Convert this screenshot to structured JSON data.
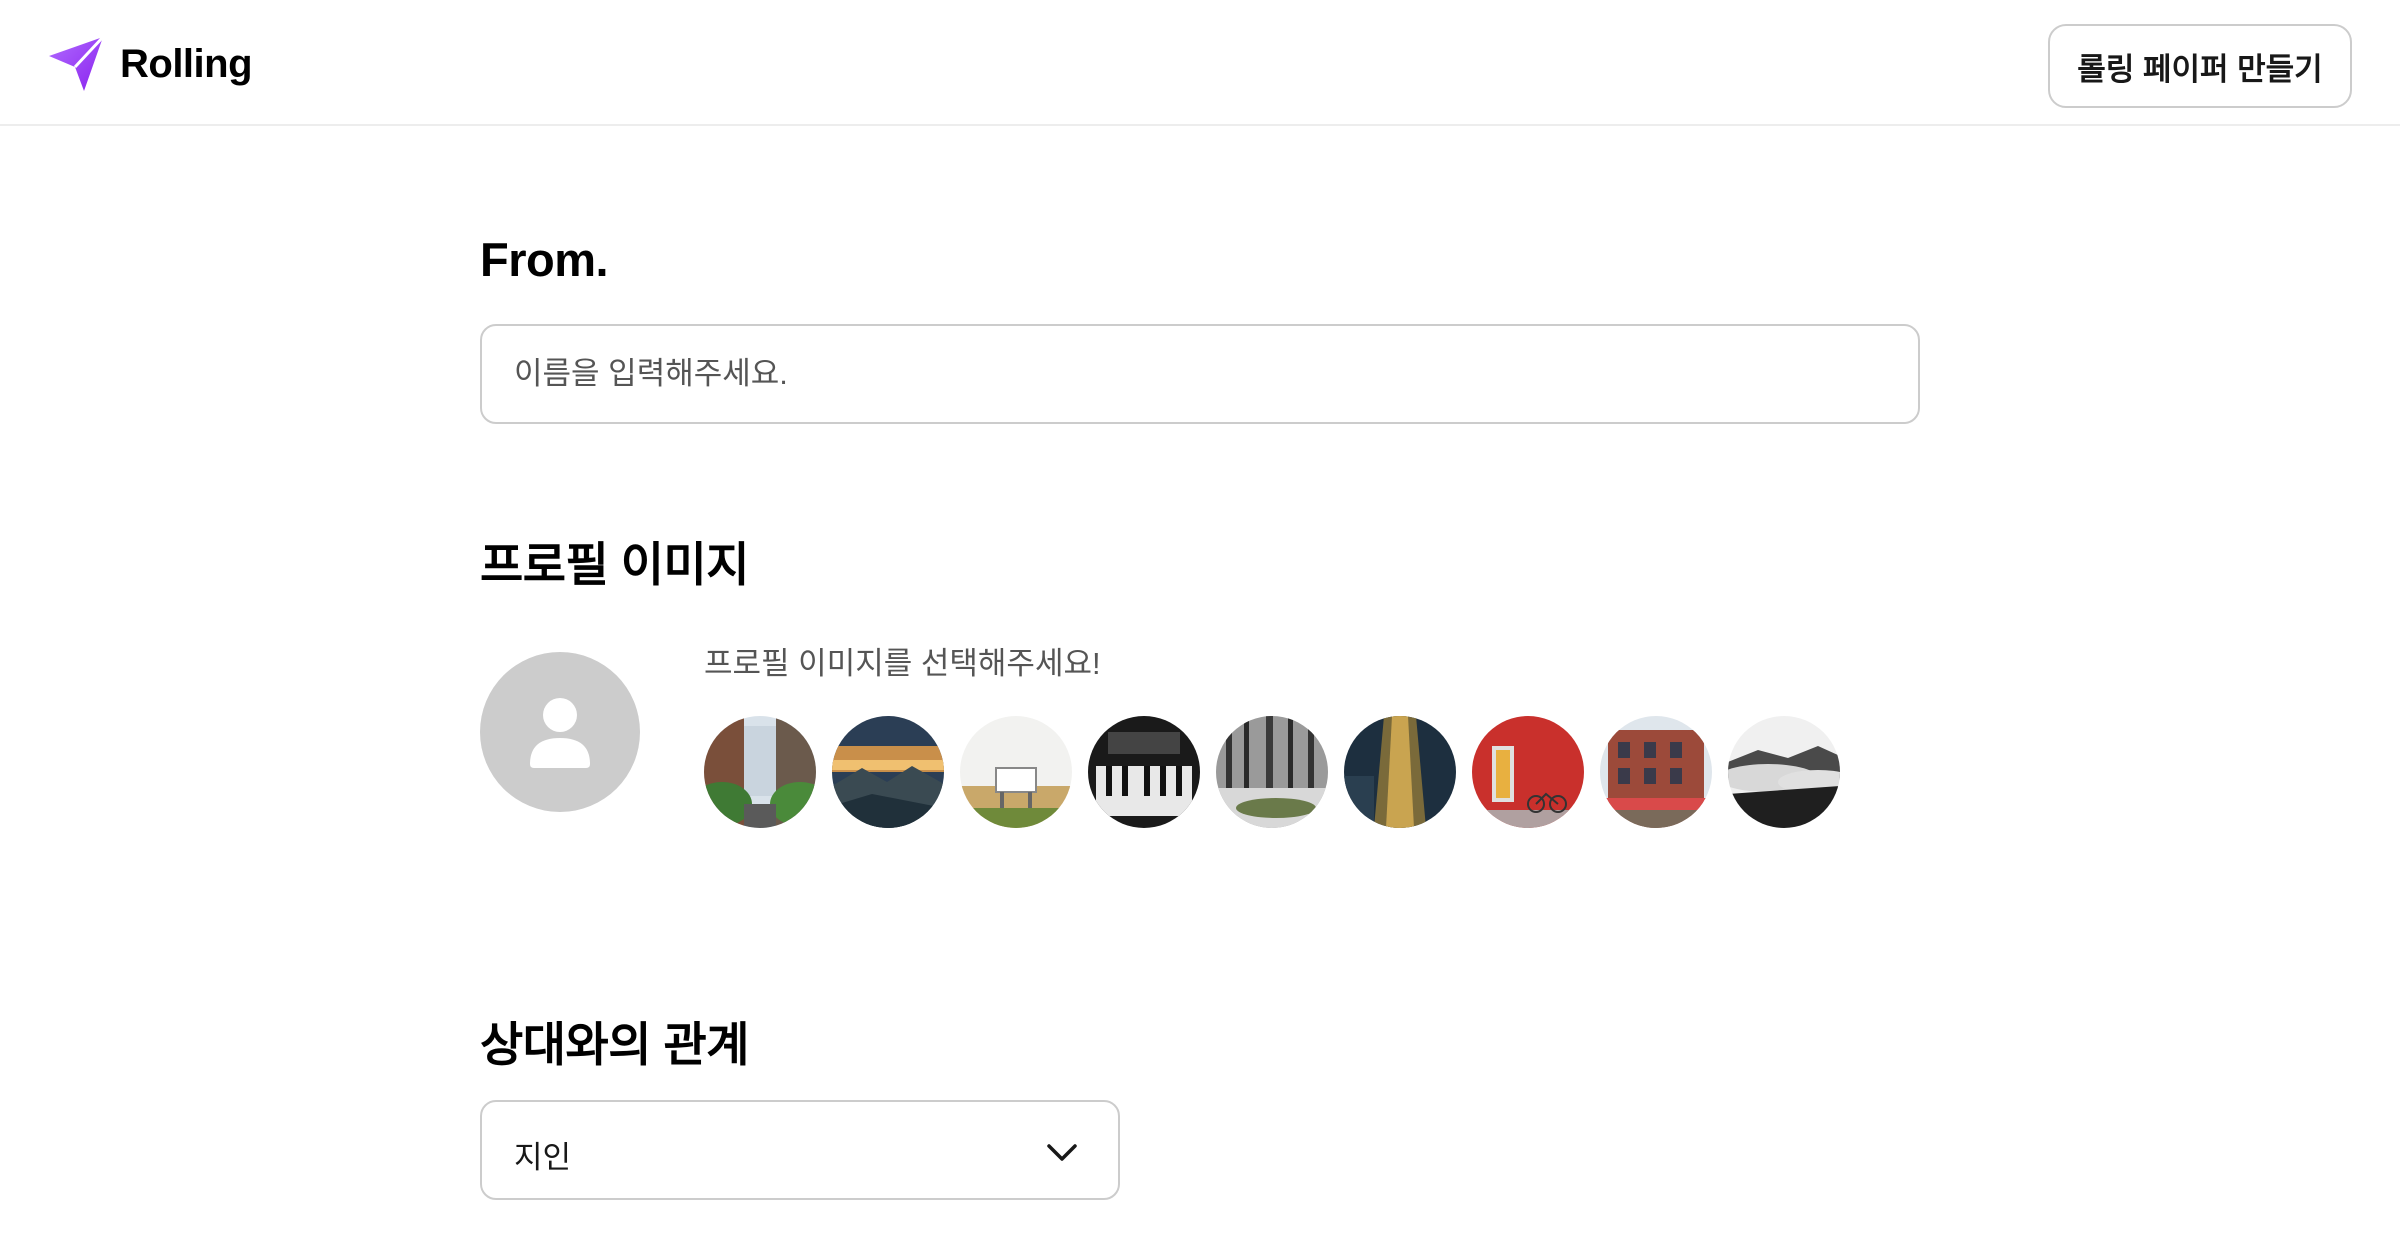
{
  "app": {
    "name": "Rolling",
    "brand_color": "#9935ff"
  },
  "header": {
    "create_button_label": "롤링 페이퍼 만들기"
  },
  "from_section": {
    "title": "From.",
    "name_placeholder": "이름을 입력해주세요.",
    "name_value": ""
  },
  "profile_section": {
    "title": "프로필 이미지",
    "hint": "프로필 이미지를 선택해주세요!",
    "default_avatar_icon": "person-icon",
    "thumbnails": [
      {
        "subject": "city street with trees"
      },
      {
        "subject": "sunset over mountains"
      },
      {
        "subject": "white chair on grass"
      },
      {
        "subject": "piano keys"
      },
      {
        "subject": "forest with snow"
      },
      {
        "subject": "lit pathway at night"
      },
      {
        "subject": "red wall with bicycle"
      },
      {
        "subject": "brick building with cafe"
      },
      {
        "subject": "mountains above clouds"
      }
    ]
  },
  "relation_section": {
    "title": "상대와의 관계",
    "selected_value": "지인",
    "chevron_icon": "chevron-down-icon"
  }
}
